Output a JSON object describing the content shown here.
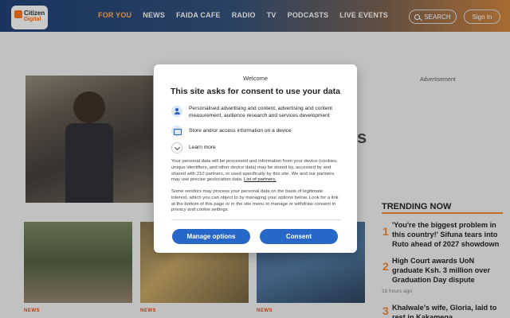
{
  "header": {
    "logo": {
      "line1": "Citizen",
      "line2": "Digital"
    },
    "nav": [
      "FOR YOU",
      "NEWS",
      "FAIDA CAFE",
      "RADIO",
      "TV",
      "PODCASTS",
      "LIVE EVENTS"
    ],
    "search_label": "SEARCH",
    "signin_label": "Sign In"
  },
  "page": {
    "advertisement_label": "Advertisement",
    "hero_fragment": "s",
    "cards": [
      {
        "tag": "NEWS"
      },
      {
        "tag": "NEWS"
      },
      {
        "tag": "NEWS"
      }
    ],
    "trending": {
      "title": "TRENDING NOW",
      "items": [
        {
          "num": "1",
          "text": "'You're the biggest problem in this country!' Sifuna tears into Ruto ahead of 2027 showdown"
        },
        {
          "num": "2",
          "text": "High Court awards UoN graduate Ksh. 3 million over Graduation Day dispute",
          "meta": "18 hours ago"
        },
        {
          "num": "3",
          "text": "Khalwale's wife, Gloria, laid to rest in Kakamega"
        }
      ]
    }
  },
  "consent": {
    "welcome": "Welcome",
    "title": "This site asks for consent to use your data",
    "purposes": [
      {
        "icon": "person-icon",
        "text": "Personalised advertising and content, advertising and content measurement, audience research and services development"
      },
      {
        "icon": "device-icon",
        "text": "Store and/or access information on a device"
      },
      {
        "icon": "chevron-down-icon",
        "text": "Learn more"
      }
    ],
    "para1": "Your personal data will be processed and information from your device (cookies, unique identifiers, and other device data) may be stored by, accessed by and shared with 210 partners, or used specifically by this site. We and our partners may use precise geolocation data.",
    "para1_link": "List of partners.",
    "para2": "Some vendors may process your personal data on the basis of legitimate interest, which you can object to by managing your options below. Look for a link at the bottom of this page or in the site menu to manage or withdraw consent in privacy and cookie settings.",
    "manage_label": "Manage options",
    "consent_label": "Consent",
    "button_color": "#2767c8"
  }
}
